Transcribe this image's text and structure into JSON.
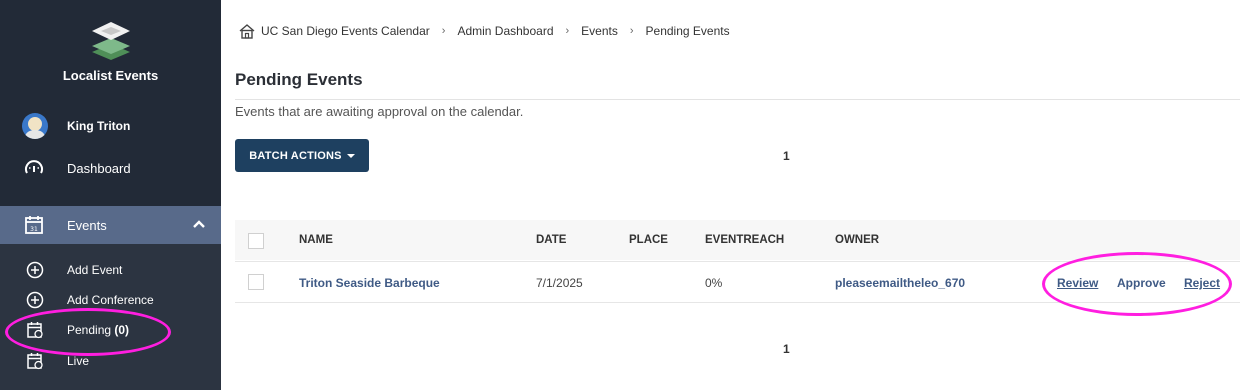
{
  "sidebar": {
    "brand": "Localist Events",
    "user_name": "King Triton",
    "nav": {
      "dashboard": "Dashboard",
      "events": "Events"
    },
    "subnav": {
      "add_event": "Add Event",
      "add_conference": "Add Conference",
      "pending_label": "Pending ",
      "pending_count": "(0)",
      "live": "Live"
    }
  },
  "breadcrumb": [
    "UC San Diego Events Calendar",
    "Admin Dashboard",
    "Events",
    "Pending Events"
  ],
  "breadcrumb_sep": "›",
  "page": {
    "title": "Pending Events",
    "description": "Events that are awaiting approval on the calendar."
  },
  "toolbar": {
    "batch_label": "BATCH ACTIONS",
    "page_top": "1",
    "page_bottom": "1"
  },
  "table": {
    "headers": {
      "name": "NAME",
      "date": "DATE",
      "place": "PLACE",
      "eventreach": "EVENTREACH",
      "owner": "OWNER"
    },
    "rows": [
      {
        "name": "Triton Seaside Barbeque",
        "date": "7/1/2025",
        "place": "",
        "eventreach": "0%",
        "owner": "pleaseemailtheleo_670",
        "actions": {
          "review": "Review",
          "approve": "Approve",
          "reject": "Reject"
        }
      }
    ]
  },
  "colors": {
    "sidebar_bg": "#222a37",
    "events_active_bg": "#586a8a",
    "button_bg": "#1e4060",
    "link": "#3f5a85",
    "annotation_highlight": "#ff1ee0"
  },
  "icons": [
    "logo-icon",
    "avatar",
    "dashboard-gauge-icon",
    "calendar-icon",
    "chevron-up-icon",
    "plus-circle-icon",
    "calendar-clock-icon",
    "home-icon",
    "caret-down-icon"
  ]
}
